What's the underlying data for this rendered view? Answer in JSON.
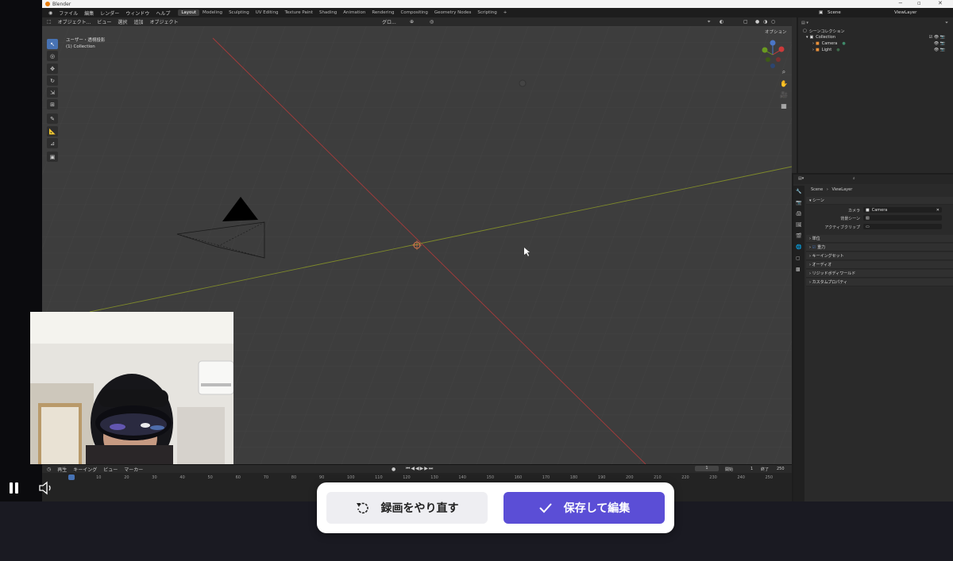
{
  "window": {
    "title": "Blender"
  },
  "topbar": {
    "menus": [
      "ファイル",
      "編集",
      "レンダー",
      "ウィンドウ",
      "ヘルプ"
    ],
    "workspaces": [
      "Layout",
      "Modeling",
      "Sculpting",
      "UV Editing",
      "Texture Paint",
      "Shading",
      "Animation",
      "Rendering",
      "Compositing",
      "Geometry Nodes",
      "Scripting",
      "+"
    ],
    "active_workspace": "Layout",
    "scene_label": "Scene",
    "viewlayer_label": "ViewLayer"
  },
  "viewport_header": {
    "mode": "オブジェクト...",
    "menus": [
      "ビュー",
      "選択",
      "追加",
      "オブジェクト"
    ],
    "transform": "グロ...",
    "options": "オプション"
  },
  "viewport": {
    "view_name": "ユーザー・透視投影",
    "collection": "(1) Collection"
  },
  "outliner": {
    "title": "シーンコレクション",
    "items": [
      {
        "label": "Collection"
      },
      {
        "label": "Camera"
      },
      {
        "label": "Light"
      }
    ]
  },
  "properties": {
    "breadcrumb_scene": "Scene",
    "breadcrumb_layer": "ViewLayer",
    "section_scene": "シーン",
    "camera_label": "カメラ",
    "camera_value": "Camera",
    "bg_scene_label": "背景シーン",
    "active_clip_label": "アクティブクリップ",
    "sections": [
      "単位",
      "重力",
      "キーイングセット",
      "オーディオ",
      "リジッドボディワールド",
      "カスタムプロパティ"
    ]
  },
  "timeline": {
    "menus": [
      "再生",
      "キーイング",
      "ビュー",
      "マーカー"
    ],
    "current_frame": "1",
    "start_label": "開始",
    "start_value": "1",
    "end_label": "終了",
    "end_value": "250",
    "ticks": [
      "0",
      "10",
      "20",
      "30",
      "40",
      "50",
      "60",
      "70",
      "80",
      "90",
      "100",
      "110",
      "120",
      "130",
      "140",
      "150",
      "160",
      "170",
      "180",
      "190",
      "200",
      "210",
      "220",
      "230",
      "240",
      "250"
    ]
  },
  "recorder": {
    "redo_label": "録画をやり直す",
    "save_label": "保存して編集"
  },
  "colors": {
    "accent": "#5b4ed6",
    "blender_active_tool": "#4772b3",
    "x_axis": "#b33a3a",
    "y_axis": "#7d8a2a"
  }
}
